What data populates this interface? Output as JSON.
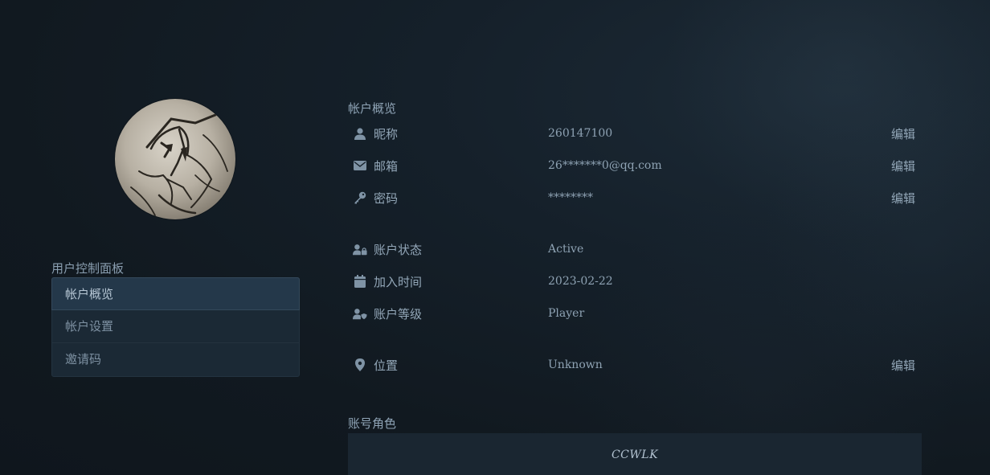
{
  "sidebar": {
    "panel_title": "用户控制面板",
    "items": [
      {
        "label": "帐户概览",
        "active": true
      },
      {
        "label": "帐户设置",
        "active": false
      },
      {
        "label": "邀请码",
        "active": false
      }
    ]
  },
  "overview": {
    "title": "帐户概览",
    "nickname": {
      "label": "昵称",
      "value": "260147100",
      "edit": "编辑",
      "icon": "user-icon"
    },
    "email": {
      "label": "邮箱",
      "value": "26*******0@qq.com",
      "edit": "编辑",
      "icon": "envelope-icon"
    },
    "password": {
      "label": "密码",
      "value": "********",
      "edit": "编辑",
      "icon": "key-icon"
    },
    "status": {
      "label": "账户状态",
      "value": "Active",
      "icon": "user-lock-icon"
    },
    "joined": {
      "label": "加入时间",
      "value": "2023-02-22",
      "icon": "calendar-icon"
    },
    "level": {
      "label": "账户等级",
      "value": "Player",
      "icon": "user-shield-icon"
    },
    "location": {
      "label": "位置",
      "value": "Unknown",
      "edit": "编辑",
      "icon": "map-marker-icon"
    }
  },
  "roles": {
    "title": "账号角色",
    "role": "CCWLK"
  },
  "colors": {
    "background": "#111920",
    "menu_bg": "#1b2935",
    "menu_active": "#24384a",
    "text": "#8fa4b6"
  }
}
